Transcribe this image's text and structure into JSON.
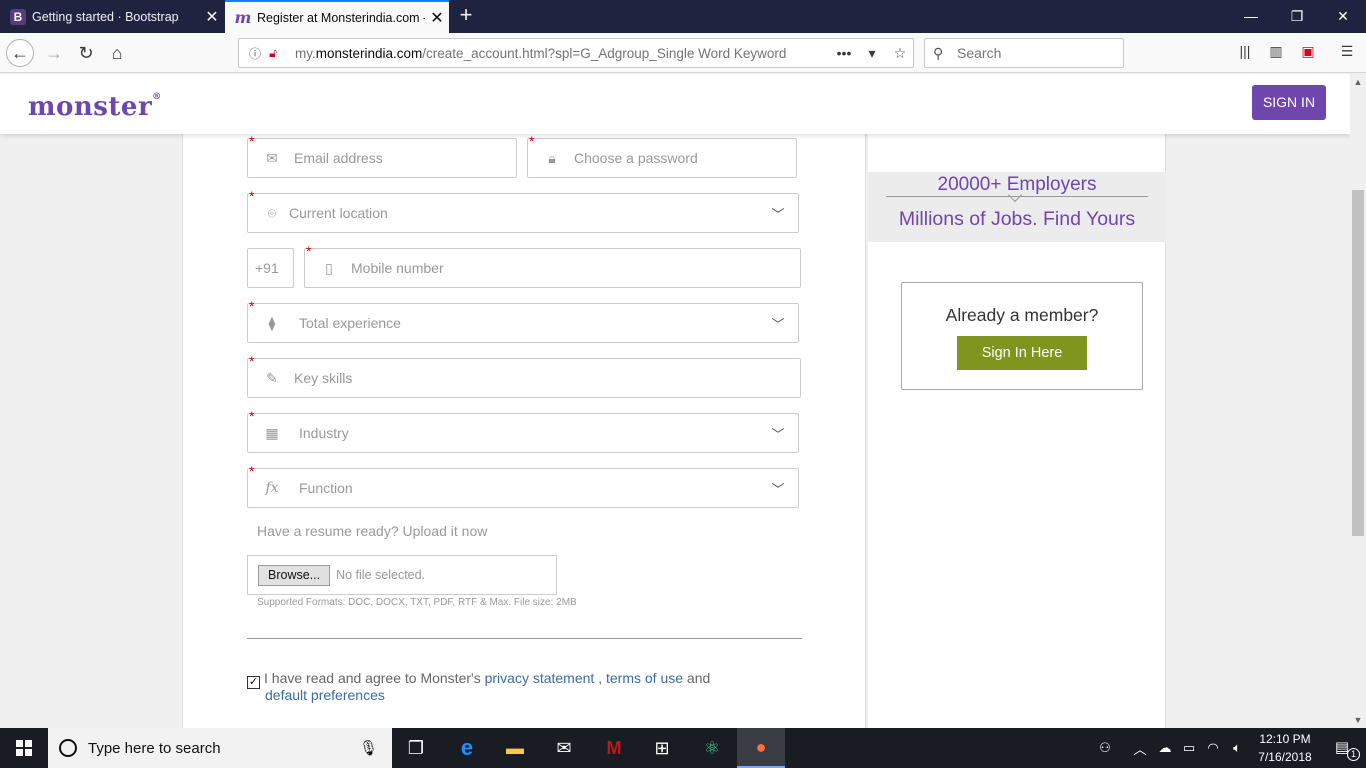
{
  "browser": {
    "tabs": [
      {
        "title": "Getting started · Bootstrap",
        "favicon": "B"
      },
      {
        "title": "Register at Monsterindia.com - ",
        "favicon": "m"
      }
    ],
    "url": {
      "prefix": "my.",
      "domain": "monsterindia.com",
      "rest": "/create_account.html?spl=G_Adgroup_Single Word Keyword "
    },
    "search_placeholder": "Search",
    "accent": "#0a84ff"
  },
  "site": {
    "logo": "monster",
    "logo_mark": "®",
    "signin": "SIGN IN",
    "brand_color": "#6e46ae"
  },
  "form": {
    "email": "Email address",
    "password": "Choose a password",
    "location": "Current location",
    "country_code": "+91",
    "mobile": "Mobile number",
    "experience": "Total experience",
    "skills": "Key skills",
    "industry": "Industry",
    "function": "Function",
    "required_mark": "*",
    "upload_prompt": "Have a resume ready? Upload it now",
    "browse": "Browse...",
    "no_file": "No file selected.",
    "formats": "Supported Formats: DOC, DOCX, TXT, PDF, RTF & Max. File size: 2MB",
    "agree_prefix": "I have read and agree to Monster's",
    "privacy": "privacy statement",
    "comma": " ,",
    "terms": "terms of use",
    "and": "and",
    "defaults": "default preferences"
  },
  "sidebar": {
    "employers": "20000+ Employers",
    "jobs": "Millions of Jobs. Find Yours",
    "member_title": "Already a member?",
    "member_btn": "Sign In Here",
    "button_color": "#7f961e"
  },
  "taskbar": {
    "search": "Type here to search",
    "time": "12:10 PM",
    "date": "7/16/2018",
    "notifications": "1"
  }
}
